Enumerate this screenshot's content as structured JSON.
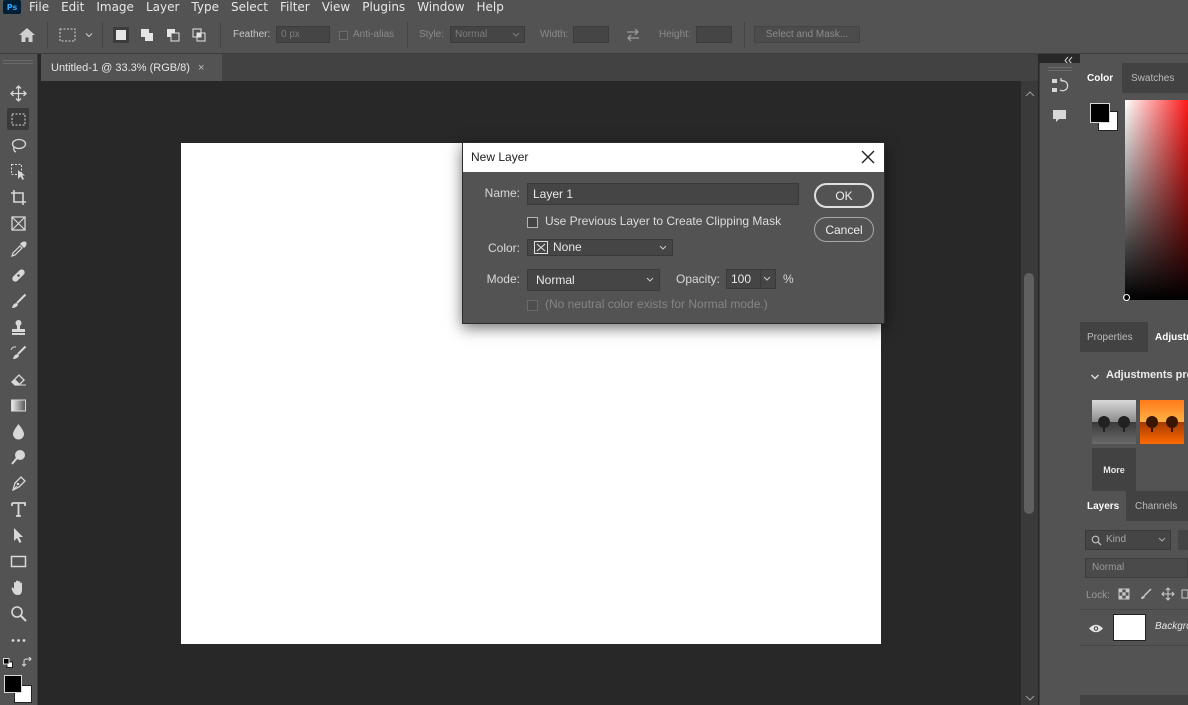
{
  "app": {
    "logo": "Ps"
  },
  "menu": [
    "File",
    "Edit",
    "Image",
    "Layer",
    "Type",
    "Select",
    "Filter",
    "View",
    "Plugins",
    "Window",
    "Help"
  ],
  "options_bar": {
    "feather_label": "Feather:",
    "feather_value": "0 px",
    "anti_alias_label": "Anti-alias",
    "style_label": "Style:",
    "style_value": "Normal",
    "width_label": "Width:",
    "height_label": "Height:",
    "select_mask_label": "Select and Mask..."
  },
  "document": {
    "tab_title": "Untitled-1 @ 33.3% (RGB/8)",
    "close_glyph": "×",
    "canvas_color": "#ffffff"
  },
  "tools": [
    "move-tool",
    "marquee-tool",
    "lasso-tool",
    "object-select-tool",
    "crop-tool",
    "frame-tool",
    "eyedropper-tool",
    "healing-brush-tool",
    "brush-tool",
    "clone-stamp-tool",
    "history-brush-tool",
    "eraser-tool",
    "gradient-tool",
    "blur-tool",
    "dodge-tool",
    "pen-tool",
    "type-tool",
    "path-select-tool",
    "rectangle-tool",
    "hand-tool",
    "zoom-tool",
    "more-tools"
  ],
  "panels": {
    "color_tabs": [
      "Color",
      "Swatches"
    ],
    "properties_tabs": [
      "Properties",
      "Adjustments"
    ],
    "adjustments_header": "Adjustments presets",
    "more_label": "More",
    "layers_tabs": [
      "Layers",
      "Channels"
    ],
    "kind_placeholder": "Kind",
    "blend_mode": "Normal",
    "lock_label": "Lock:",
    "layer_name": "Background"
  },
  "dialog": {
    "title": "New Layer",
    "name_label": "Name:",
    "name_value": "Layer 1",
    "clipping_label": "Use Previous Layer to Create Clipping Mask",
    "clipping_checked": false,
    "color_label": "Color:",
    "color_value": "None",
    "mode_label": "Mode:",
    "mode_value": "Normal",
    "opacity_label": "Opacity:",
    "opacity_value": "100",
    "percent": "%",
    "neutral_label": "(No neutral color exists for Normal mode.)",
    "ok_label": "OK",
    "cancel_label": "Cancel"
  },
  "colors": {
    "foreground": "#000000",
    "background": "#ffffff",
    "ui_gray": "#535353",
    "canvas_bg": "#282828"
  }
}
